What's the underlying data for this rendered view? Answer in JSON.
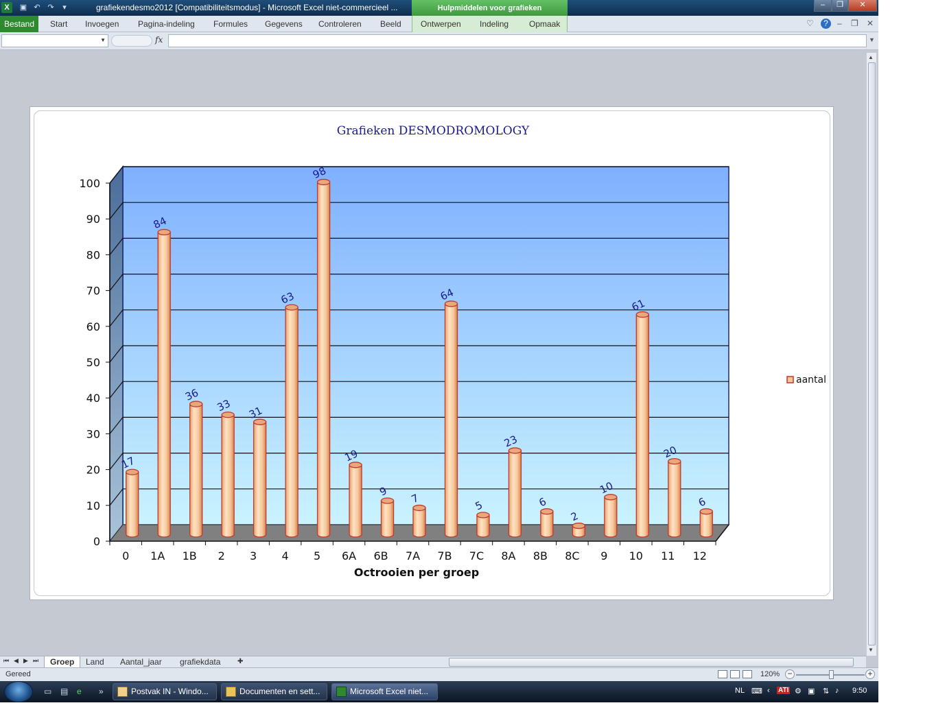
{
  "window": {
    "title": "grafiekendesmo2012  [Compatibiliteitsmodus]  -  Microsoft Excel niet-commercieel ...",
    "contextual_group": "Hulpmiddelen voor grafieken",
    "app_icon": "X",
    "qat_icons": [
      "save-icon",
      "undo-icon",
      "redo-icon",
      "customize-icon"
    ],
    "window_buttons": [
      "–",
      "❐",
      "✕"
    ]
  },
  "ribbon": {
    "tabs": [
      "Bestand",
      "Start",
      "Invoegen",
      "Pagina-indeling",
      "Formules",
      "Gegevens",
      "Controleren",
      "Beeld",
      "Ontwerpen",
      "Indeling",
      "Opmaak"
    ],
    "right_controls": [
      "♡",
      "?",
      "–",
      "❐",
      "✕"
    ]
  },
  "formula_bar": {
    "name_box": "",
    "fx_label": "fx",
    "formula": ""
  },
  "chart_data": {
    "type": "bar",
    "title": "Grafieken DESMODROMOLOGY",
    "xlabel": "Octrooien per groep",
    "ylabel": "",
    "categories": [
      "0",
      "1A",
      "1B",
      "2",
      "3",
      "4",
      "5",
      "6A",
      "6B",
      "7A",
      "7B",
      "7C",
      "8A",
      "8B",
      "8C",
      "9",
      "10",
      "11",
      "12"
    ],
    "series": [
      {
        "name": "aantal",
        "values": [
          17,
          84,
          36,
          33,
          31,
          63,
          98,
          19,
          9,
          7,
          64,
          5,
          23,
          6,
          2,
          10,
          61,
          20,
          6
        ]
      }
    ],
    "ylim": [
      0,
      100
    ],
    "yticks": [
      0,
      10,
      20,
      30,
      40,
      50,
      60,
      70,
      80,
      90,
      100
    ],
    "grid": true,
    "legend_position": "right",
    "bar_shape": "cylinder",
    "colors": {
      "bar_fill": "#f6c79a",
      "bar_edge": "#c0392b",
      "wall_top": "#7fb0ff",
      "wall_bottom": "#c9f3ff",
      "floor": "#808080",
      "data_label": "#1a1a8c",
      "title": "#1a1a8c"
    }
  },
  "sheets": {
    "tabs": [
      "Groep",
      "Land",
      "Aantal_jaar",
      "grafiekdata"
    ],
    "active": "Groep",
    "nav": [
      "⏮",
      "◀",
      "▶",
      "⏭"
    ]
  },
  "status": {
    "ready": "Gereed",
    "zoom": "120%",
    "zoom_minus": "−",
    "zoom_plus": "+"
  },
  "taskbar": {
    "tasks": [
      "Postvak IN - Windo...",
      "Documenten en sett...",
      "Microsoft Excel niet..."
    ],
    "active_task": 2,
    "language": "NL",
    "clock": "9:50",
    "ati_label": "ATI"
  }
}
